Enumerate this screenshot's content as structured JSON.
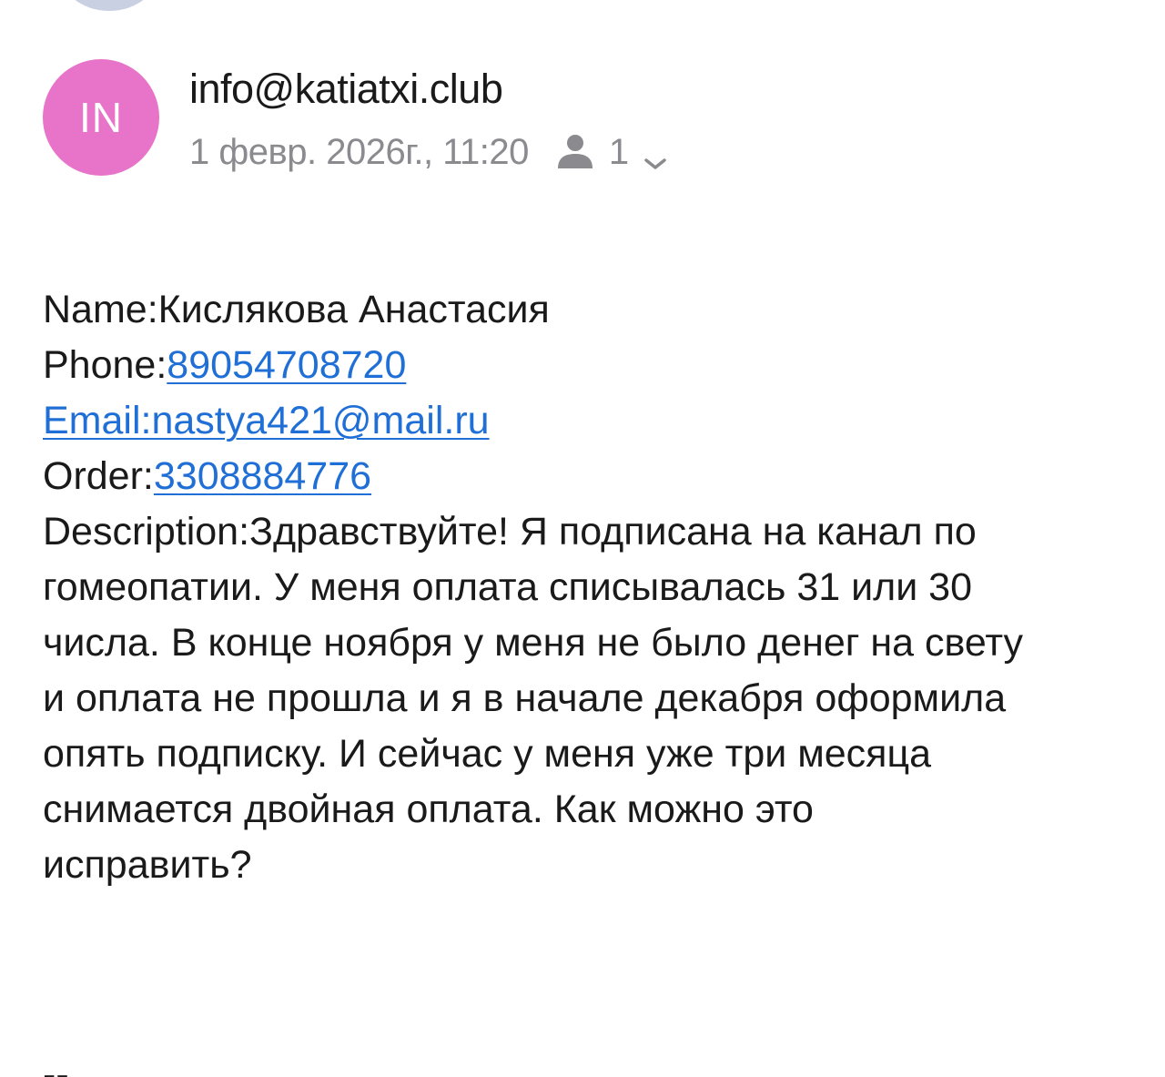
{
  "sender": {
    "avatar_initials": "IN",
    "avatar_color": "#e874c9",
    "email": "info@katiatxi.club",
    "date": "1 февр. 2026г., 11:20",
    "recipients_count": "1",
    "recipients_icon": "person-icon",
    "expand_icon": "chevron-down-icon"
  },
  "body": {
    "name_label": "Name:",
    "name_value": "Кислякова Анастасия",
    "phone_label": "Phone:",
    "phone_value": "89054708720",
    "email_link": "Email:nastya421@mail.ru",
    "order_label": "Order:",
    "order_value": "3308884776",
    "description_lines": [
      "Description:Здравствуйте! Я подписана на канал по",
      "гомеопатии. У меня оплата списывалась 31 или 30",
      "числа. В конце ноября у меня не было денег на свету",
      "и оплата не прошла и я в начале декабря оформила",
      "опять подписку. И сейчас у меня уже три месяца",
      "снимается двойная оплата. Как можно это",
      "исправить?"
    ],
    "signature_separator": "--"
  },
  "colors": {
    "link": "#1f6fd6",
    "meta_text": "#8a8a8f"
  }
}
